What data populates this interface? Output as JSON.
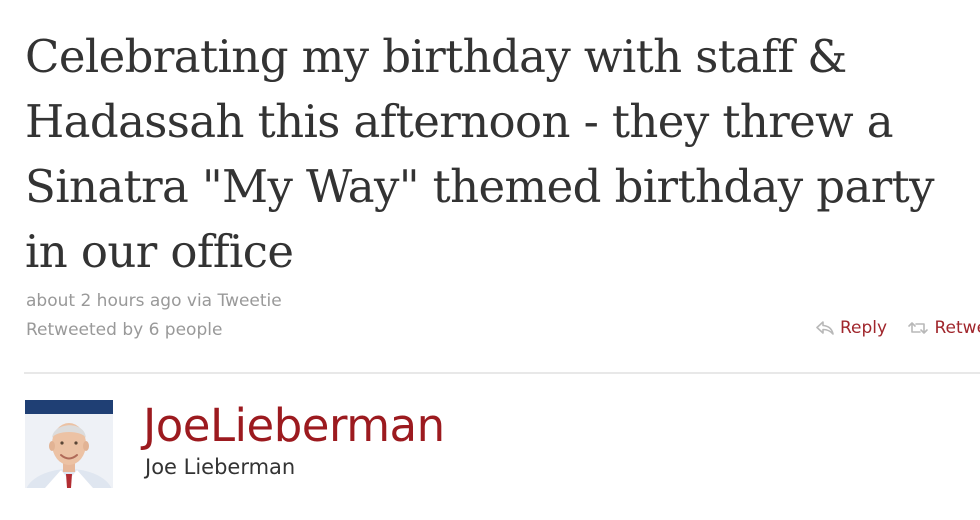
{
  "tweet": {
    "text": "Celebrating my birthday with staff & Hadassah this afternoon - they threw a Sinatra \"My Way\" themed birthday party in our office",
    "time": "about 2 hours ago",
    "via_prefix": "via",
    "source": "Tweetie",
    "retweeted_by": "Retweeted by 6 people"
  },
  "actions": {
    "reply_label": "Reply",
    "reply_icon": "reply-arrow-icon",
    "retweet_label": "Retweet",
    "retweet_icon": "retweet-arrows-icon"
  },
  "author": {
    "screen_name": "JoeLieberman",
    "full_name": "Joe Lieberman"
  },
  "colors": {
    "text": "#333333",
    "meta": "#999999",
    "link": "#a0262c",
    "screen_name": "#9c1a1f",
    "divider": "#e8e8e8"
  }
}
